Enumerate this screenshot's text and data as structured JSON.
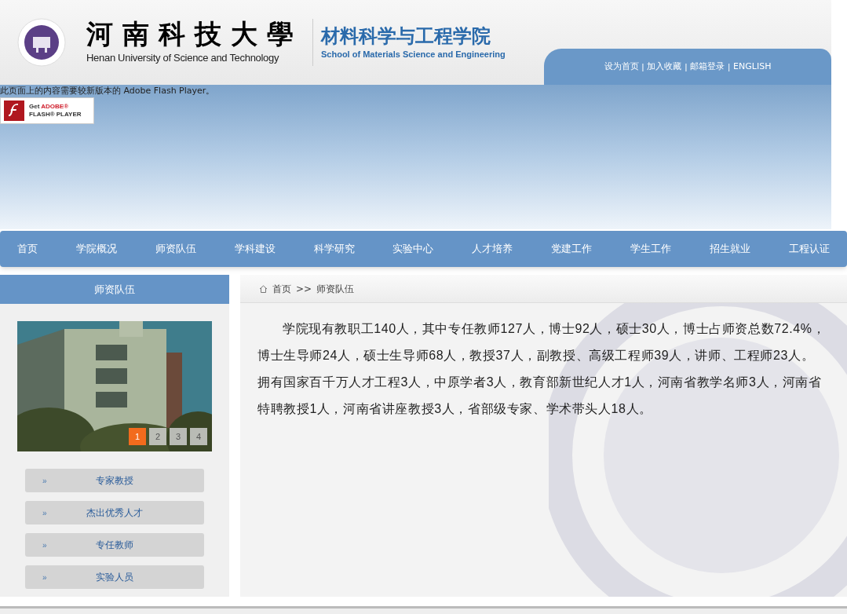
{
  "header": {
    "university_cn": "河南科技大學",
    "university_en": "Henan University of Science and Technology",
    "college_cn": "材料科学与工程学院",
    "college_en": "School of Materials Science and Engineering",
    "top_links": [
      "设为首页",
      "加入收藏",
      "邮箱登录",
      "ENGLISH"
    ],
    "separator": "|"
  },
  "flash_notice": {
    "message": "此页面上的内容需要较新版本的 Adobe Flash Player。",
    "badge_get": "Get",
    "badge_brand": "ADOBE®",
    "badge_product": "FLASH® PLAYER"
  },
  "nav": [
    {
      "label": "首页",
      "selected": false
    },
    {
      "label": "学院概况",
      "selected": false
    },
    {
      "label": "师资队伍",
      "selected": false
    },
    {
      "label": "学科建设",
      "selected": false
    },
    {
      "label": "科学研究",
      "selected": false
    },
    {
      "label": "实验中心",
      "selected": false
    },
    {
      "label": "人才培养",
      "selected": false
    },
    {
      "label": "党建工作",
      "selected": false
    },
    {
      "label": "学生工作",
      "selected": false
    },
    {
      "label": "招生就业",
      "selected": false
    },
    {
      "label": "工程认证",
      "selected": false
    }
  ],
  "sidebar": {
    "title": "师资队伍",
    "slider": [
      {
        "label": "1",
        "selected": true
      },
      {
        "label": "2",
        "selected": false
      },
      {
        "label": "3",
        "selected": false
      },
      {
        "label": "4",
        "selected": false
      }
    ],
    "items": [
      {
        "marker": "»",
        "label": "专家教授"
      },
      {
        "marker": "»",
        "label": "杰出优秀人才"
      },
      {
        "marker": "»",
        "label": "专任教师"
      },
      {
        "marker": "»",
        "label": "实验人员"
      }
    ]
  },
  "breadcrumb": [
    "首页",
    ">>",
    "师资队伍"
  ],
  "content": {
    "paragraph": "学院现有教职工140人，其中专任教师127人，博士92人，硕士30人，博士占师资总数72.4%，博士生导师24人，硕士生导师68人，教授37人，副教授、高级工程师39人，讲师、工程师23人。拥有国家百千万人才工程3人，中原学者3人，教育部新世纪人才1人，河南省教学名师3人，河南省特聘教授1人，河南省讲座教授3人，省部级专家、学术带头人18人。"
  }
}
